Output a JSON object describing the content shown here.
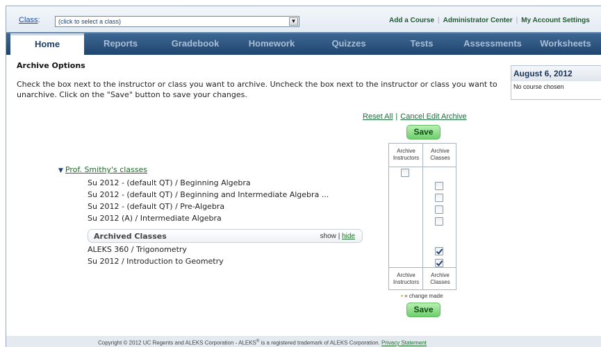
{
  "topbar": {
    "class_label": "Class",
    "class_colon": ":",
    "class_select_value": "(click to select a class)",
    "links": [
      "Add a Course",
      "Administrator Center",
      "My Account Settings"
    ]
  },
  "nav": {
    "tabs": [
      {
        "label": "Home",
        "active": true
      },
      {
        "label": "Reports",
        "active": false
      },
      {
        "label": "Gradebook",
        "active": false
      },
      {
        "label": "Homework",
        "active": false
      },
      {
        "label": "Quizzes",
        "active": false
      },
      {
        "label": "Tests",
        "active": false
      },
      {
        "label": "Assessments",
        "active": false
      },
      {
        "label": "Worksheets",
        "active": false
      }
    ]
  },
  "main": {
    "title": "Archive Options",
    "instructions": "Check the box next to the instructor or class you want to archive. Uncheck the box next to the instructor or class you want to unarchive. Click on the \"Save\" button to save your changes.",
    "reset_all": "Reset All",
    "link_separator": "|",
    "cancel_edit": "Cancel Edit Archive",
    "save_label": "Save",
    "columns": {
      "instructors": "Archive Instructors",
      "classes": "Archive Classes"
    },
    "change_legend_star": "•",
    "change_legend_text": " = change made"
  },
  "date_panel": {
    "date": "August 6, 2012",
    "course_status": "No course chosen"
  },
  "instructor": {
    "toggle_glyph": "▼",
    "name": "Prof. Smithy's classes",
    "archive_checked": false
  },
  "classes": [
    {
      "name": "Su 2012 - (default QT) / Beginning Algebra",
      "archived": false
    },
    {
      "name": "Su 2012 - (default QT) / Beginning and Intermediate Algebra ...",
      "archived": false
    },
    {
      "name": "Su 2012 - (default QT) / Pre-Algebra",
      "archived": false
    },
    {
      "name": "Su 2012 (A) / Intermediate Algebra",
      "archived": false
    }
  ],
  "archived_section": {
    "title": "Archived Classes",
    "show": "show",
    "separator": "|",
    "hide": "hide"
  },
  "archived_classes": [
    {
      "name": "ALEKS 360 / Trigonometry",
      "archived": true
    },
    {
      "name": "Su 2012 / Introduction to Geometry",
      "archived": true
    }
  ],
  "footer": {
    "copyright": "Copyright © 2012 UC Regents and ALEKS Corporation - ALEKS",
    "reg": "®",
    "trademark": " is a registered trademark of ALEKS Corporation. ",
    "privacy": "Privacy Statement"
  }
}
